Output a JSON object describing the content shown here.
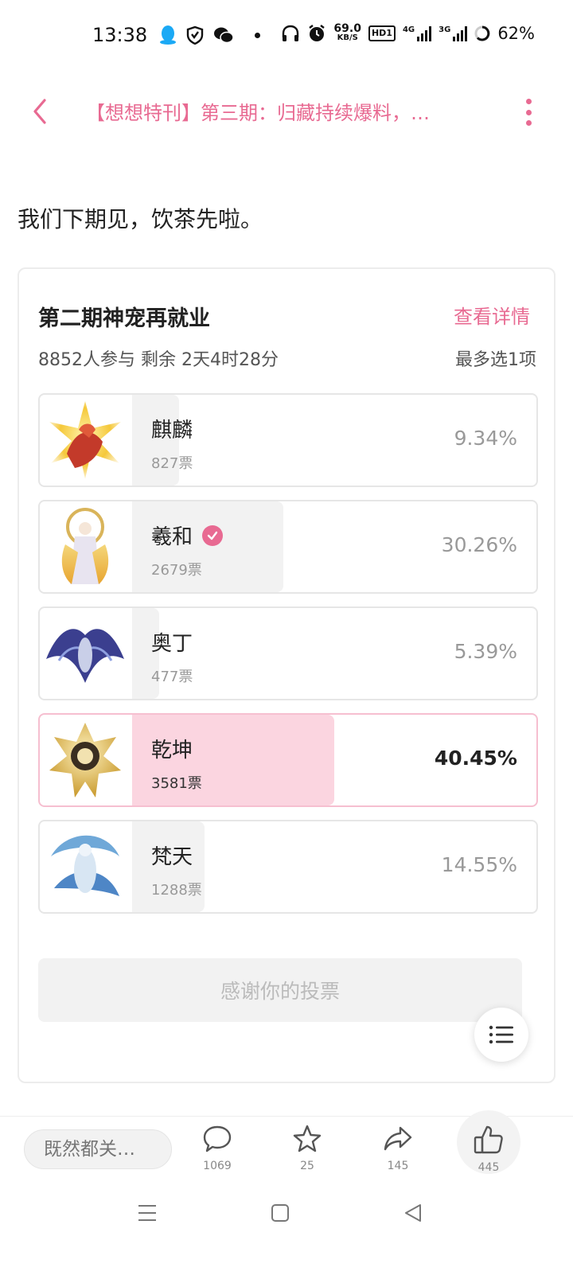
{
  "status": {
    "time": "13:38",
    "net_speed_value": "69.0",
    "net_speed_unit": "KB/S",
    "hd_label": "HD1",
    "signal1": "4G",
    "signal2": "3G",
    "battery": "62%"
  },
  "header": {
    "title": "【想想特刊】第三期：归藏持续爆料，…"
  },
  "intro_text": "我们下期见，饮茶先啦。",
  "poll": {
    "title": "第二期神宠再就业",
    "detail_link": "查看详情",
    "meta": "8852人参与 剩余 2天4时28分",
    "limit": "最多选1项",
    "options": [
      {
        "name": "麒麟",
        "votes": "827票",
        "percent": "9.34%",
        "share": 0.0934,
        "selected": false
      },
      {
        "name": "羲和",
        "votes": "2679票",
        "percent": "30.26%",
        "share": 0.3026,
        "selected": false,
        "verified": true
      },
      {
        "name": "奥丁",
        "votes": "477票",
        "percent": "5.39%",
        "share": 0.0539,
        "selected": false
      },
      {
        "name": "乾坤",
        "votes": "3581票",
        "percent": "40.45%",
        "share": 0.4045,
        "selected": true
      },
      {
        "name": "梵天",
        "votes": "1288票",
        "percent": "14.55%",
        "share": 0.1455,
        "selected": false
      }
    ],
    "vote_button": "感谢你的投票"
  },
  "bottom_bar": {
    "comment_placeholder": "既然都关…",
    "comments_count": "1069",
    "favorites_count": "25",
    "shares_count": "145",
    "likes_count": "445"
  },
  "colors": {
    "accent": "#e86a92",
    "selected_fill": "#fbd5e0",
    "bar_fill": "#f2f2f2"
  }
}
